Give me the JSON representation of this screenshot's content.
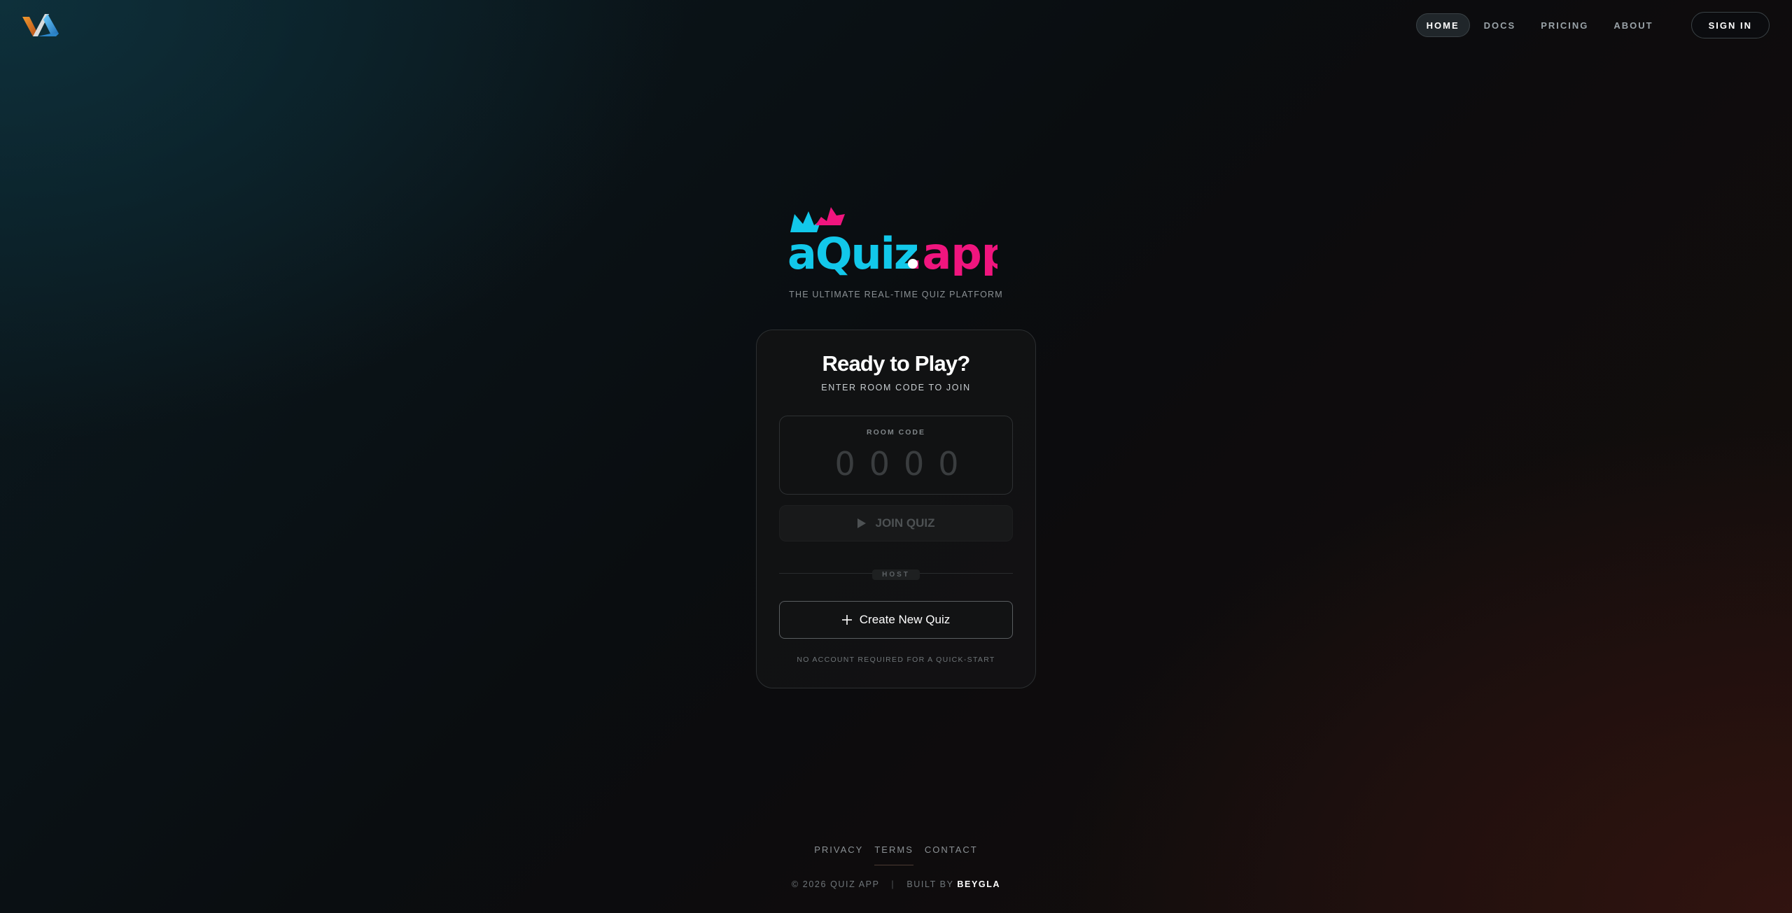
{
  "nav": {
    "items": [
      {
        "label": "HOME",
        "active": true
      },
      {
        "label": "DOCS",
        "active": false
      },
      {
        "label": "PRICING",
        "active": false
      },
      {
        "label": "ABOUT",
        "active": false
      }
    ],
    "signin_label": "SIGN IN"
  },
  "hero": {
    "logo_main": "aQuiz",
    "logo_suffix": ".app",
    "tagline": "THE ULTIMATE REAL-TIME QUIZ PLATFORM"
  },
  "card": {
    "title": "Ready to Play?",
    "subtitle": "ENTER ROOM CODE TO JOIN",
    "room_code_label": "ROOM CODE",
    "room_code_placeholder": "0000",
    "room_code_value": "",
    "join_label": "JOIN QUIZ",
    "join_disabled": true,
    "divider_label": "HOST",
    "create_label": "Create New Quiz",
    "note": "NO ACCOUNT REQUIRED FOR A QUICK-START"
  },
  "footer": {
    "links": [
      {
        "label": "PRIVACY",
        "active": false
      },
      {
        "label": "TERMS",
        "active": true
      },
      {
        "label": "CONTACT",
        "active": false
      }
    ],
    "copyright": "© 2026 QUIZ APP",
    "separator": "|",
    "built_by_prefix": "BUILT BY",
    "built_by_name": "BEYGLA"
  },
  "icons": {
    "brand": "brand-logo-icon",
    "join": "play-icon",
    "create": "plus-icon"
  },
  "colors": {
    "logo_cyan": "#12c8ea",
    "logo_pink": "#f0157e",
    "brand_orange": "#e07a22",
    "brand_blue": "#3aa6e6"
  }
}
